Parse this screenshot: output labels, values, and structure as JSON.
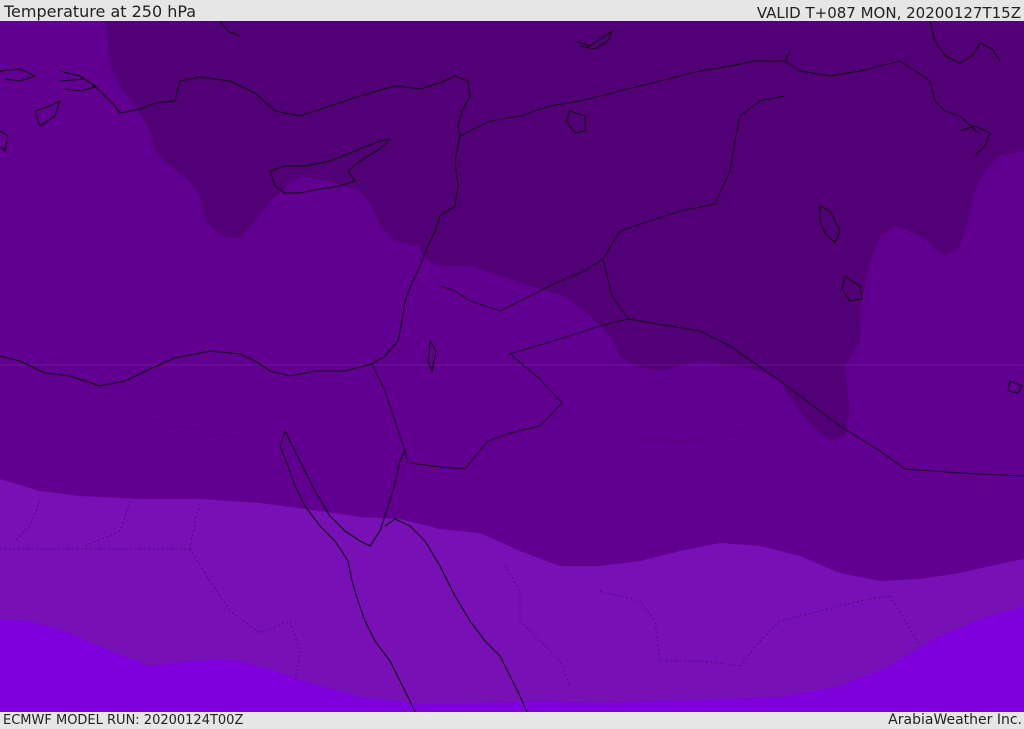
{
  "header": {
    "title": "Temperature at 250 hPa",
    "valid": "VALID T+087 MON, 20200127T15Z"
  },
  "footer": {
    "model_run": "ECMWF MODEL RUN: 20200124T00Z",
    "credit": "ArabiaWeather Inc."
  },
  "map": {
    "colors": {
      "coldest_band": "#520075",
      "cold_band": "#610090",
      "mid_band": "#7710b5",
      "warm_band": "#7d00dd",
      "coastline": "#111111"
    }
  }
}
